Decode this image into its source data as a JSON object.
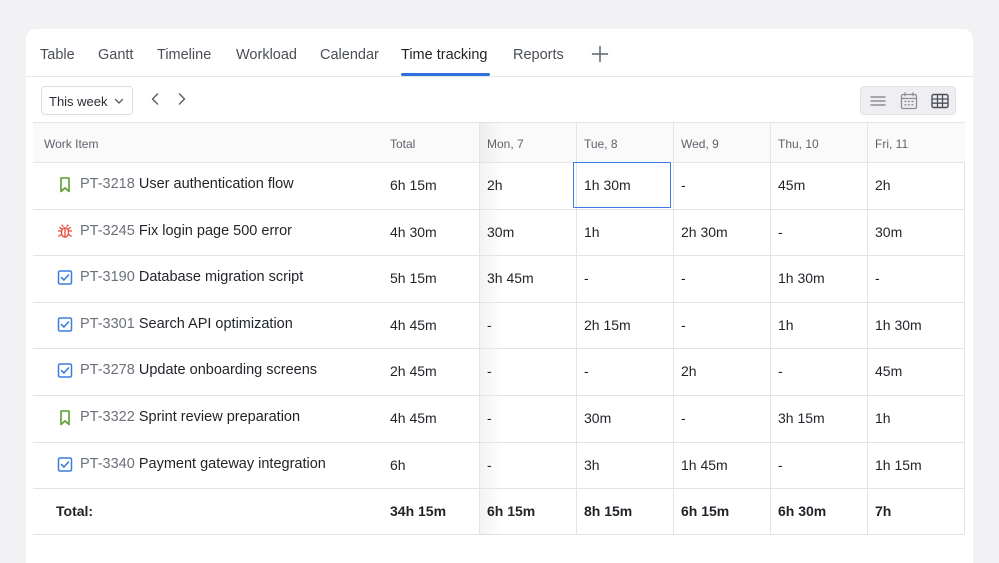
{
  "tabs": [
    {
      "label": "Table",
      "active": false
    },
    {
      "label": "Gantt",
      "active": false
    },
    {
      "label": "Timeline",
      "active": false
    },
    {
      "label": "Workload",
      "active": false
    },
    {
      "label": "Calendar",
      "active": false
    },
    {
      "label": "Time tracking",
      "active": true
    },
    {
      "label": "Reports",
      "active": false
    }
  ],
  "toolbar": {
    "period_select": "This week",
    "view_modes": [
      "list-view-icon",
      "calendar-view-icon",
      "table-view-icon"
    ],
    "active_view": "table-view-icon"
  },
  "colors": {
    "accent": "#2f6fe0",
    "story_icon": "#5a9e2f",
    "bug_icon": "#e5493a",
    "task_icon": "#3b7ddd"
  },
  "table": {
    "headers": [
      "Work Item",
      "Total",
      "Mon, 7",
      "Tue, 8",
      "Wed, 9",
      "Thu, 10",
      "Fri, 11"
    ],
    "rows": [
      {
        "type": "story-icon",
        "key": "PT-3218",
        "title": "User authentication flow",
        "total": "6h 15m",
        "days": [
          "2h",
          "1h 30m",
          "-",
          "45m",
          "2h"
        ]
      },
      {
        "type": "bug-icon",
        "key": "PT-3245",
        "title": "Fix login page 500 error",
        "total": "4h 30m",
        "days": [
          "30m",
          "1h",
          "2h 30m",
          "-",
          "30m"
        ]
      },
      {
        "type": "task-icon",
        "key": "PT-3190",
        "title": "Database migration script",
        "total": "5h 15m",
        "days": [
          "3h 45m",
          "-",
          "-",
          "1h 30m",
          "-"
        ]
      },
      {
        "type": "task-icon",
        "key": "PT-3301",
        "title": "Search API optimization",
        "total": "4h 45m",
        "days": [
          "-",
          "2h 15m",
          "-",
          "1h",
          "1h 30m"
        ]
      },
      {
        "type": "task-icon",
        "key": "PT-3278",
        "title": "Update onboarding screens",
        "total": "2h 45m",
        "days": [
          "-",
          "-",
          "2h",
          "-",
          "45m"
        ]
      },
      {
        "type": "story-icon",
        "key": "PT-3322",
        "title": "Sprint review preparation",
        "total": "4h 45m",
        "days": [
          "-",
          "30m",
          "-",
          "3h 15m",
          "1h"
        ]
      },
      {
        "type": "task-icon",
        "key": "PT-3340",
        "title": "Payment gateway integration",
        "total": "6h",
        "days": [
          "-",
          "3h",
          "1h 45m",
          "-",
          "1h 15m"
        ]
      }
    ],
    "footer": {
      "label": "Total:",
      "total": "34h 15m",
      "days": [
        "6h 15m",
        "8h 15m",
        "6h 15m",
        "6h 30m",
        "7h"
      ]
    },
    "selected_cell": {
      "row": 0,
      "day": 1
    }
  }
}
